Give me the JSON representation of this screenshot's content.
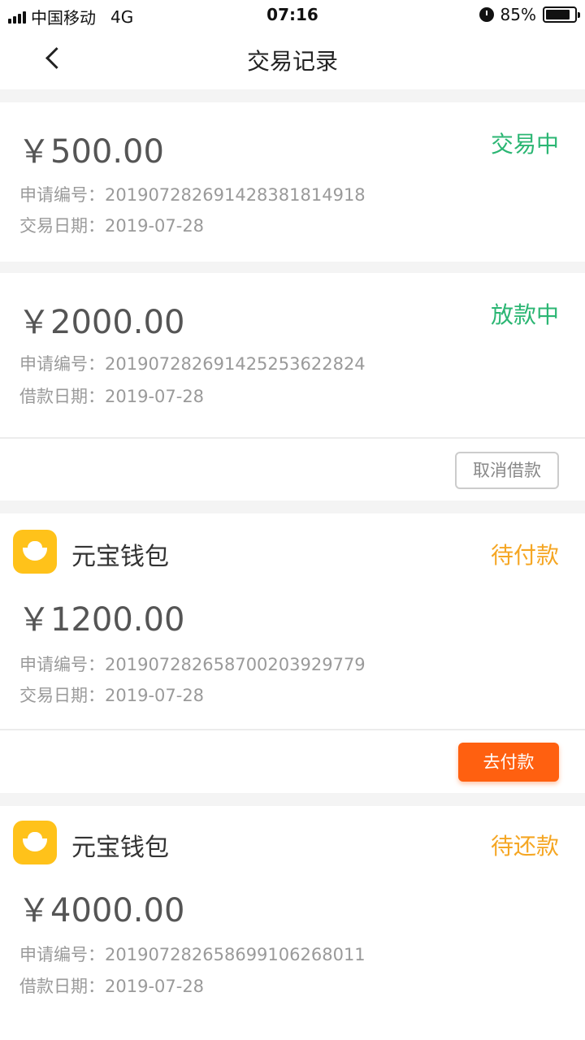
{
  "status_bar": {
    "carrier": "中国移动",
    "network": "4G",
    "time": "07:16",
    "battery": "85%",
    "battery_level": 0.85
  },
  "nav": {
    "title": "交易记录"
  },
  "records": [
    {
      "amount": "￥500.00",
      "status": "交易中",
      "app_label": "申请编号：",
      "app_no": "20190728269142838181491 8",
      "date_label": "交易日期：",
      "date": "2019-07-28"
    },
    {
      "amount": "￥2000.00",
      "status": "放款中",
      "app_label": "申请编号：",
      "app_no": "201907282691425253622824",
      "date_label": "借款日期：",
      "date": "2019-07-28",
      "action": "取消借款"
    },
    {
      "brand": "元宝钱包",
      "amount": "￥1200.00",
      "status": "待付款",
      "app_label": "申请编号：",
      "app_no": "201907282658700203929779",
      "date_label": "交易日期：",
      "date": "2019-07-28",
      "action": "去付款"
    },
    {
      "brand": "元宝钱包",
      "amount": "￥4000.00",
      "status": "待还款",
      "app_label": "申请编号：",
      "app_no": "201907282658699106268011",
      "date_label": "借款日期：",
      "date": "2019-07-28"
    }
  ],
  "colors": {
    "status_green": "#2bb673",
    "status_orange": "#f5a623",
    "primary_button": "#ff6010"
  }
}
